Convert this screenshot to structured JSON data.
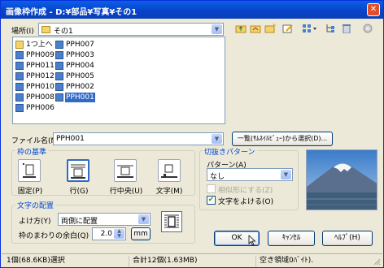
{
  "window": {
    "title": "画像枠作成 - D:¥部品¥写真¥その1",
    "close_glyph": "✕"
  },
  "location": {
    "label": "場所(I)",
    "value": "その1"
  },
  "files": {
    "col1": [
      {
        "name": "1つ上へ",
        "type": "up"
      },
      {
        "name": "PPH009",
        "type": "image"
      },
      {
        "name": "PPH011",
        "type": "image"
      },
      {
        "name": "PPH012",
        "type": "image"
      },
      {
        "name": "PPH010",
        "type": "image"
      },
      {
        "name": "PPH008",
        "type": "image"
      },
      {
        "name": "PPH006",
        "type": "image"
      }
    ],
    "col2": [
      {
        "name": "PPH007",
        "type": "image"
      },
      {
        "name": "PPH003",
        "type": "image"
      },
      {
        "name": "PPH004",
        "type": "image"
      },
      {
        "name": "PPH005",
        "type": "image"
      },
      {
        "name": "PPH002",
        "type": "image"
      },
      {
        "name": "PPH001",
        "type": "image",
        "selected": true
      }
    ]
  },
  "filename": {
    "label": "ファイル名(N)",
    "value": "PPH001"
  },
  "select_from_list_button": "一覧(ｻﾑﾈｲﾙﾋﾞｭｰ)から選択(D)...",
  "frame_basis": {
    "title": "枠の基準",
    "buttons": [
      {
        "label": "固定(P)"
      },
      {
        "label": "行(G)",
        "active": true
      },
      {
        "label": "行中央(U)"
      },
      {
        "label": "文字(M)"
      }
    ]
  },
  "cutout_pattern": {
    "title": "切抜きパターン",
    "pattern_label": "パターン(A)",
    "pattern_value": "なし",
    "similar_label": "相似形にする(Z)",
    "avoid_text_label": "文字をよける(O)",
    "avoid_text_checked": true,
    "check_glyph": "✔"
  },
  "text_layout": {
    "title": "文字の配置",
    "avoid_label": "よけ方(Y)",
    "avoid_value": "両側に配置",
    "margin_label": "枠のまわりの余白(Q)",
    "margin_value": "2.0",
    "unit": "mm"
  },
  "buttons": {
    "ok": "OK",
    "cancel": "ｷｬﾝｾﾙ",
    "help": "ﾍﾙﾌﾟ(H)"
  },
  "status": {
    "selection": "1個(68.6KB)選択",
    "total": "合計12個(1.63MB)",
    "free": "空き領域0ﾊﾞｲﾄ)."
  },
  "icons": {
    "toolbar": [
      "up-folder-icon",
      "home-folder-icon",
      "new-folder-icon",
      "edit-icon",
      "view-options-icon",
      "tree-icon",
      "delete-icon",
      "stop-icon"
    ]
  },
  "colors": {
    "accent": "#316ac5",
    "group_title": "#0046d5",
    "titlebar": "#0a5fe6"
  }
}
